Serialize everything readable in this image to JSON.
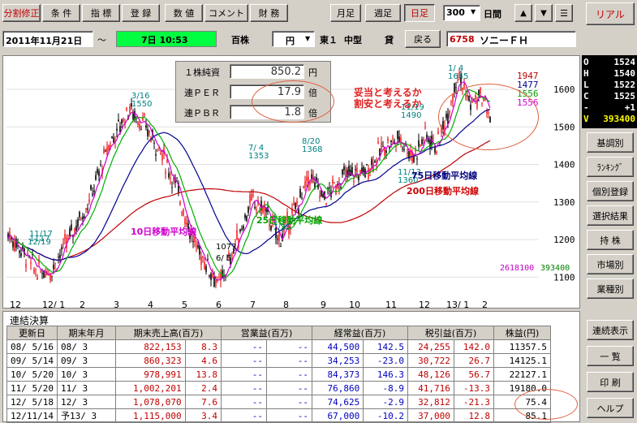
{
  "toolbar": {
    "tabs": [
      "分割修正",
      "条 件",
      "指 標",
      "登 録",
      "数 値",
      "コメント",
      "財 務"
    ],
    "period_buttons": [
      "月足",
      "週足",
      "日足"
    ],
    "active_period": 2,
    "count_value": "300",
    "count_unit": "日間",
    "arrow_up": "▲",
    "arrow_down": "▼",
    "menu": "☰",
    "realtime": "リアル"
  },
  "info_bar": {
    "date": "2011年11月21日",
    "tilde": "～",
    "day_time": "7日 10:53",
    "unit": "百株",
    "currency": "円",
    "market": "東１",
    "size": "中型",
    "margin": "貸",
    "back": "戻る",
    "code": "6758",
    "name": "ソニーＦＨ"
  },
  "indicators": {
    "bps_label": "１株純資",
    "bps_value": "850.2",
    "bps_unit": "円",
    "per_label": "連ＰＥＲ",
    "per_value": "17.9",
    "per_unit": "倍",
    "pbr_label": "連ＰＢＲ",
    "pbr_value": "1.8",
    "pbr_unit": "倍"
  },
  "annotations": {
    "question1": "妥当と考えるか",
    "question2": "割安と考えるか",
    "ma10": "10日移動平均線",
    "ma25": "25日移動平均線",
    "ma75": "75日移動平均線",
    "ma200": "200日移動平均線"
  },
  "ohlc": {
    "O": "1524",
    "H": "1540",
    "L": "1522",
    "C": "1525",
    "diff": "+1",
    "V": "393400"
  },
  "chart_data": {
    "type": "candlestick",
    "y_ticks": [
      1100,
      1200,
      1300,
      1400,
      1500,
      1600
    ],
    "ylim": [
      1040,
      1680
    ],
    "x_labels": [
      "12",
      "12/ 1",
      "2",
      "3",
      "4",
      "5",
      "6",
      "7",
      "8",
      "9",
      "10",
      "11",
      "12",
      "13/ 1",
      "2"
    ],
    "price_labels": [
      {
        "date": "11/17",
        "price": "1117"
      },
      {
        "date": "12/19",
        "price": ""
      },
      {
        "date": "3/16",
        "price": "1550"
      },
      {
        "date": "6/ 5",
        "price": "1077"
      },
      {
        "date": "7/ 4",
        "price": "1353"
      },
      {
        "date": "7/25",
        "price": ""
      },
      {
        "date": "8/20",
        "price": "1368"
      },
      {
        "date": "11/19",
        "price": "1490"
      },
      {
        "date": "11/13",
        "price": "1360"
      },
      {
        "date": "1/ 4",
        "price": "1645"
      }
    ],
    "right_prices": [
      "1947",
      "1477",
      "1556",
      "1556"
    ],
    "volume_left": "2618100",
    "volume_right": "393400"
  },
  "table": {
    "title": "連結決算",
    "headers": [
      "更新日",
      "期末年月",
      "期末売上高(百万)",
      "営業益(百万)",
      "経常益(百万)",
      "税引益(百万)",
      "株益(円)"
    ],
    "rows": [
      [
        "08/ 5/16",
        "08/ 3",
        "822,153",
        "8.3",
        "--",
        "--",
        "44,500",
        "142.5",
        "24,255",
        "142.0",
        "11357.5"
      ],
      [
        "09/ 5/14",
        "09/ 3",
        "860,323",
        "4.6",
        "--",
        "--",
        "34,253",
        "-23.0",
        "30,722",
        "26.7",
        "14125.1"
      ],
      [
        "10/ 5/20",
        "10/ 3",
        "978,991",
        "13.8",
        "--",
        "--",
        "84,373",
        "146.3",
        "48,126",
        "56.7",
        "22127.1"
      ],
      [
        "11/ 5/20",
        "11/ 3",
        "1,002,201",
        "2.4",
        "--",
        "--",
        "76,860",
        "-8.9",
        "41,716",
        "-13.3",
        "19180.0"
      ],
      [
        "12/ 5/18",
        "12/ 3",
        "1,078,070",
        "7.6",
        "--",
        "--",
        "74,625",
        "-2.9",
        "32,812",
        "-21.3",
        "75.4"
      ],
      [
        "12/11/14",
        "予13/ 3",
        "1,115,000",
        "3.4",
        "--",
        "--",
        "67,000",
        "-10.2",
        "37,000",
        "12.8",
        "85.1"
      ]
    ]
  },
  "side_buttons": [
    "基調別",
    "ﾗﾝｷﾝｸﾞ",
    "個別登録",
    "選択結果",
    "持 株",
    "市場別",
    "業種別",
    "連続表示",
    "一 覧",
    "印 刷",
    "ヘルプ"
  ]
}
